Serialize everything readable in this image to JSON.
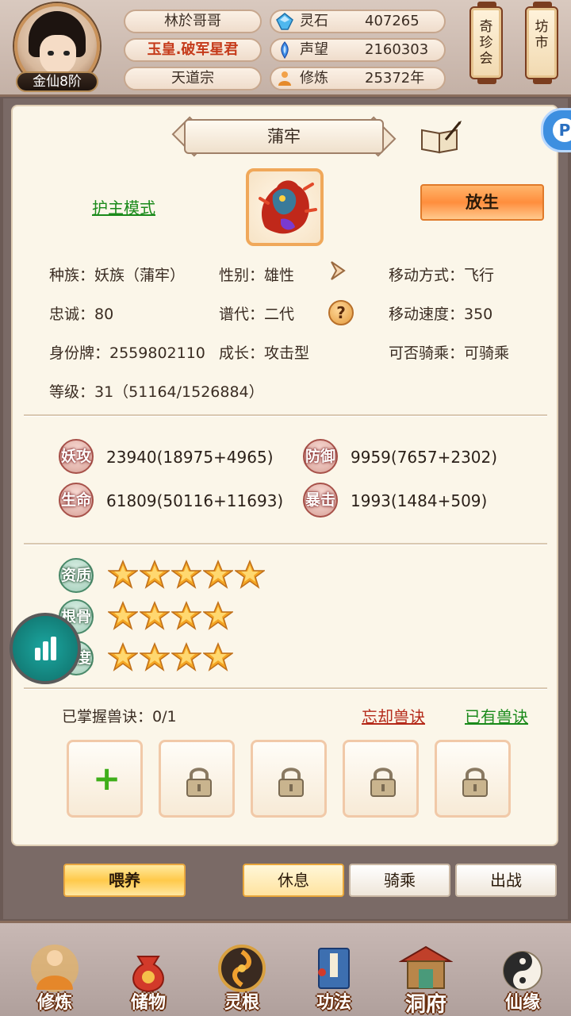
{
  "header": {
    "rank_label": "金仙8阶",
    "player_name": "林於哥哥",
    "title": "玉皇.破军星君",
    "sect": "天道宗",
    "resources": [
      {
        "icon": "spirit-stone-icon",
        "label": "灵石",
        "value": "407265"
      },
      {
        "icon": "prestige-icon",
        "label": "声望",
        "value": "2160303"
      },
      {
        "icon": "cultivation-icon",
        "label": "修炼",
        "value": "25372年"
      }
    ],
    "lanterns": [
      {
        "label": "奇珍会"
      },
      {
        "label": "坊市"
      }
    ]
  },
  "pet": {
    "name": "蒲牢",
    "guard_mode_link": "护主模式",
    "release_button": "放生",
    "attributes": {
      "race": "种族：妖族（蒲牢）",
      "gender": "性别：雄性",
      "move_type": "移动方式：飞行",
      "loyalty": "忠诚：80",
      "generation": "谱代：二代",
      "move_speed": "移动速度：350",
      "id_tag": "身份牌：2559802110",
      "growth": "成长：攻击型",
      "rideable": "可否骑乘：可骑乘",
      "level": "等级：31（51164/1526884）"
    },
    "help_icon": "?",
    "stats": [
      {
        "badge": "妖攻",
        "value": "23940(18975+4965)"
      },
      {
        "badge": "防御",
        "value": "9959(7657+2302)"
      },
      {
        "badge": "生命",
        "value": "61809(50116+11693)"
      },
      {
        "badge": "暴击",
        "value": "1993(1484+509)"
      }
    ],
    "qualities": [
      {
        "badge": "资质",
        "stars": 5
      },
      {
        "badge": "根骨",
        "stars": 4
      },
      {
        "badge": "悟度",
        "stars": 4
      }
    ],
    "skills": {
      "mastered_label": "已掌握兽诀：0/1",
      "forget_link": "忘却兽诀",
      "owned_link": "已有兽诀",
      "slots": [
        "add",
        "locked",
        "locked",
        "locked",
        "locked"
      ]
    }
  },
  "actions": {
    "feed": "喂养",
    "tabs": [
      "休息",
      "骑乘",
      "出战"
    ],
    "active_tab": "休息"
  },
  "side_tab_label": "P",
  "nav": [
    {
      "icon": "cultivate-icon",
      "label": "修炼"
    },
    {
      "icon": "storage-bag-icon",
      "label": "储物"
    },
    {
      "icon": "spirit-root-icon",
      "label": "灵根"
    },
    {
      "icon": "technique-book-icon",
      "label": "功法"
    },
    {
      "icon": "cave-mansion-icon",
      "label": "洞府"
    },
    {
      "icon": "fate-icon",
      "label": "仙缘"
    }
  ],
  "colors": {
    "accent_orange": "#ff8e3d",
    "link_green": "#1a8a1a",
    "link_red": "#b52a1a",
    "star_gold": "#f5a623"
  }
}
